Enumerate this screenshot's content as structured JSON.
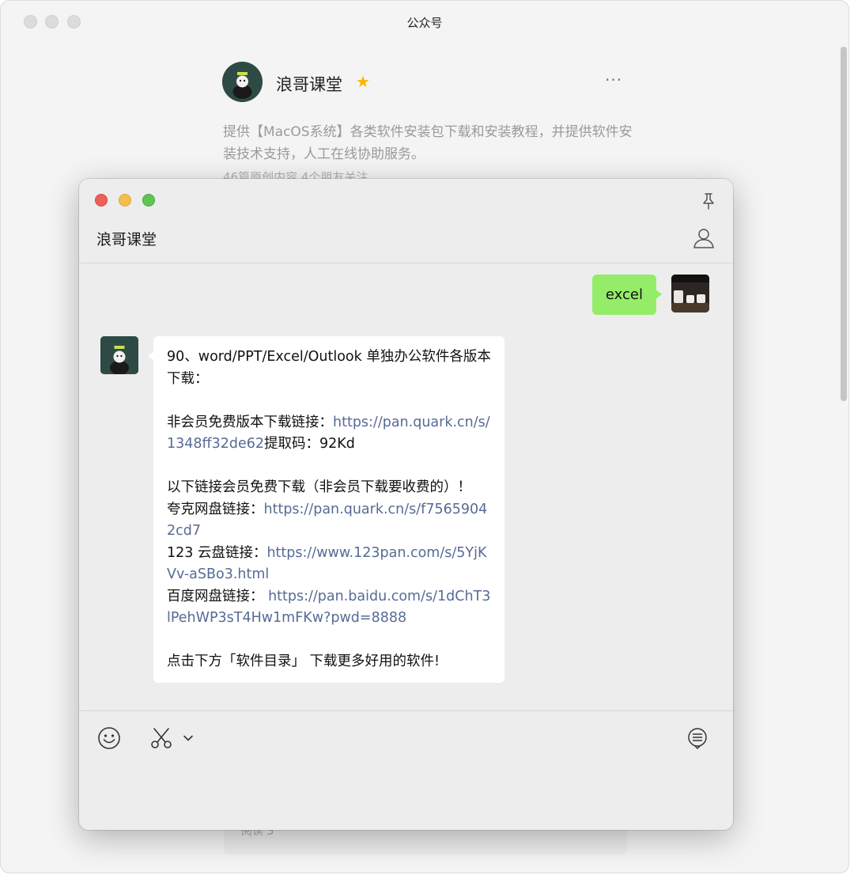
{
  "background_window": {
    "title": "公众号",
    "account_name": "浪哥课堂",
    "description": "提供【MacOS系统】各类软件安装包下载和安装教程，并提供软件安装技术支持，人工在线协助服务。",
    "stats": "46篇原创内容  4个朋友关注",
    "footer_text": "阅读 5"
  },
  "chat_window": {
    "title": "浪哥课堂",
    "sent_message": "excel",
    "received_message": {
      "line1": "90、word/PPT/Excel/Outlook 单独办公软件各版本下载：",
      "nonmember_label": "非会员免费版本下载链接：",
      "nonmember_link": "https://pan.quark.cn/s/1348ff32de62",
      "code_label": "提取码：92Kd",
      "member_line": "以下链接会员免费下载（非会员下载要收费的）！",
      "quark_label": "夸克网盘链接：",
      "quark_link": "https://pan.quark.cn/s/f75659042cd7",
      "pan123_label": "123 云盘链接：",
      "pan123_link": "https://www.123pan.com/s/5YjKVv-aSBo3.html",
      "baidu_label": "百度网盘链接： ",
      "baidu_link": "https://pan.baidu.com/s/1dChT3lPehWP3sT4Hw1mFKw?pwd=8888",
      "footer_line": "点击下方「软件目录」 下载更多好用的软件!"
    }
  },
  "colors": {
    "sent_bubble": "#95ec69",
    "link": "#576b95",
    "close": "#ee5f57",
    "minimize": "#f4be4f",
    "zoom": "#5fc454",
    "star": "#f5b800"
  },
  "icons": {
    "pin": "pin-icon",
    "contact": "contact-icon",
    "emoji": "emoji-icon",
    "scissors": "scissors-icon",
    "chevron": "chevron-down-icon",
    "chat_history": "chat-history-icon",
    "star": "star-icon",
    "more": "more-icon"
  }
}
